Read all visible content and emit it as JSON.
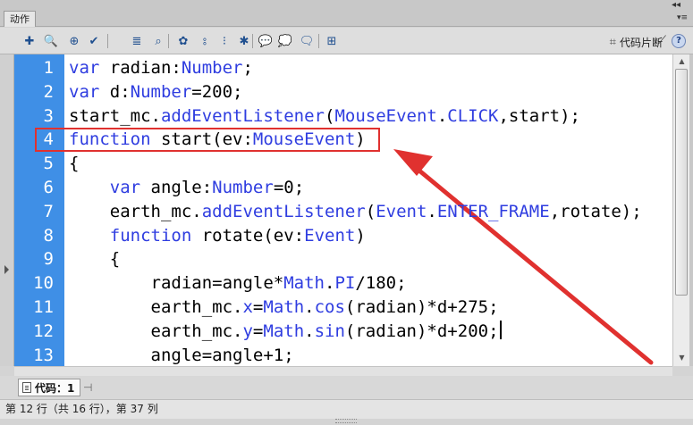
{
  "panel": {
    "tab_label": "动作",
    "collapse_glyph": "◂◂",
    "menu_glyph": "▾≡"
  },
  "toolbar": {
    "buttons": [
      {
        "name": "add-statement-icon",
        "glyph": "✚"
      },
      {
        "name": "find-icon",
        "glyph": "🔍"
      },
      {
        "name": "target-path-icon",
        "glyph": "⊕"
      },
      {
        "name": "check-syntax-icon",
        "glyph": "✔"
      },
      {
        "name": "auto-format-icon",
        "glyph": "≣"
      },
      {
        "name": "code-hint-icon",
        "glyph": "⌕"
      },
      {
        "name": "debug-options-icon",
        "glyph": "✿"
      },
      {
        "name": "collapse-between-braces-icon",
        "glyph": "⦂"
      },
      {
        "name": "collapse-selection-icon",
        "glyph": "⁝"
      },
      {
        "name": "expand-all-icon",
        "glyph": "✱"
      },
      {
        "name": "apply-block-comment-icon",
        "glyph": "💬"
      },
      {
        "name": "apply-line-comment-icon",
        "glyph": "💭"
      },
      {
        "name": "remove-comment-icon",
        "glyph": "🗨"
      },
      {
        "name": "show-hide-toolbox-icon",
        "glyph": "⊞"
      }
    ],
    "snippets_label": "代码片断",
    "help_glyph": "?"
  },
  "editor": {
    "lines": [
      {
        "n": "1",
        "parts": [
          [
            "kw",
            "var"
          ],
          [
            "t",
            " radian:"
          ],
          [
            "cls",
            "Number"
          ],
          [
            "t",
            ";"
          ]
        ]
      },
      {
        "n": "2",
        "parts": [
          [
            "kw",
            "var"
          ],
          [
            "t",
            " d:"
          ],
          [
            "cls",
            "Number"
          ],
          [
            "t",
            "=200;"
          ]
        ]
      },
      {
        "n": "3",
        "parts": [
          [
            "t",
            "start_mc."
          ],
          [
            "cls",
            "addEventListener"
          ],
          [
            "t",
            "("
          ],
          [
            "cls",
            "MouseEvent"
          ],
          [
            "t",
            "."
          ],
          [
            "cls",
            "CLICK"
          ],
          [
            "t",
            ",start);"
          ]
        ]
      },
      {
        "n": "4",
        "parts": [
          [
            "kw",
            "function"
          ],
          [
            "t",
            " start(ev:"
          ],
          [
            "cls",
            "MouseEvent"
          ],
          [
            "t",
            ")"
          ]
        ]
      },
      {
        "n": "5",
        "parts": [
          [
            "t",
            "{"
          ]
        ]
      },
      {
        "n": "6",
        "parts": [
          [
            "t",
            "    "
          ],
          [
            "kw",
            "var"
          ],
          [
            "t",
            " angle:"
          ],
          [
            "cls",
            "Number"
          ],
          [
            "t",
            "=0;"
          ]
        ]
      },
      {
        "n": "7",
        "parts": [
          [
            "t",
            "    earth_mc."
          ],
          [
            "cls",
            "addEventListener"
          ],
          [
            "t",
            "("
          ],
          [
            "cls",
            "Event"
          ],
          [
            "t",
            "."
          ],
          [
            "cls",
            "ENTER_FRAME"
          ],
          [
            "t",
            ",rotate);"
          ]
        ]
      },
      {
        "n": "8",
        "parts": [
          [
            "t",
            "    "
          ],
          [
            "kw",
            "function"
          ],
          [
            "t",
            " rotate(ev:"
          ],
          [
            "cls",
            "Event"
          ],
          [
            "t",
            ")"
          ]
        ]
      },
      {
        "n": "9",
        "parts": [
          [
            "t",
            "    {"
          ]
        ]
      },
      {
        "n": "10",
        "parts": [
          [
            "t",
            "        radian=angle*"
          ],
          [
            "cls",
            "Math"
          ],
          [
            "t",
            "."
          ],
          [
            "cls",
            "PI"
          ],
          [
            "t",
            "/180;"
          ]
        ]
      },
      {
        "n": "11",
        "parts": [
          [
            "t",
            "        earth_mc."
          ],
          [
            "cls",
            "x"
          ],
          [
            "t",
            "="
          ],
          [
            "cls",
            "Math"
          ],
          [
            "t",
            "."
          ],
          [
            "cls",
            "cos"
          ],
          [
            "t",
            "(radian)*d+275;"
          ]
        ]
      },
      {
        "n": "12",
        "parts": [
          [
            "t",
            "        earth_mc."
          ],
          [
            "cls",
            "y"
          ],
          [
            "t",
            "="
          ],
          [
            "cls",
            "Math"
          ],
          [
            "t",
            "."
          ],
          [
            "cls",
            "sin"
          ],
          [
            "t",
            "(radian)*d+200;"
          ],
          [
            "caret",
            ""
          ]
        ]
      },
      {
        "n": "13",
        "parts": [
          [
            "t",
            "        angle=angle+1;"
          ]
        ]
      }
    ],
    "highlighted_line": "4",
    "colors": {
      "gutter": "#3f8fe6",
      "keyword": "#2f3de0",
      "annotation": "#e0312f"
    }
  },
  "tabs": {
    "code_tab_label": "代码：1",
    "pin_glyph": "⊣"
  },
  "status": {
    "text": "第 12 行（共 16 行），第 37 列"
  }
}
